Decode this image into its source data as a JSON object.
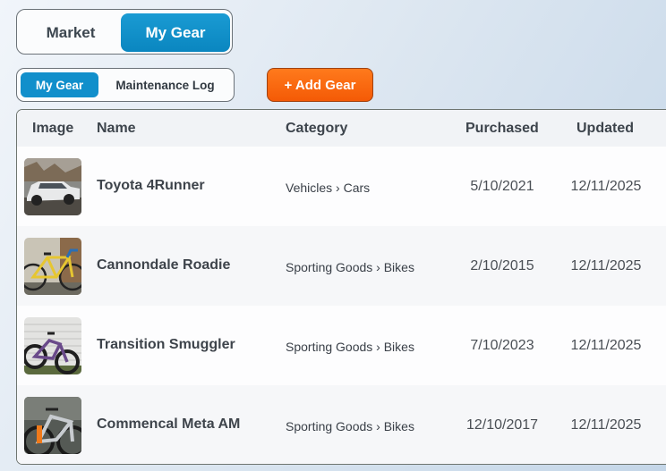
{
  "top_tabs": {
    "market": "Market",
    "my_gear": "My Gear"
  },
  "sub_tabs": {
    "my_gear": "My Gear",
    "maintenance_log": "Maintenance Log"
  },
  "add_gear_label": "+ Add Gear",
  "table": {
    "headers": {
      "image": "Image",
      "name": "Name",
      "category": "Category",
      "purchased": "Purchased",
      "updated": "Updated"
    },
    "rows": [
      {
        "name": "Toyota 4Runner",
        "category": "Vehicles › Cars",
        "purchased": "5/10/2021",
        "updated": "12/11/2025",
        "thumb": "suv"
      },
      {
        "name": "Cannondale Roadie",
        "category": "Sporting Goods › Bikes",
        "purchased": "2/10/2015",
        "updated": "12/11/2025",
        "thumb": "road-bike"
      },
      {
        "name": "Transition Smuggler",
        "category": "Sporting Goods › Bikes",
        "purchased": "7/10/2023",
        "updated": "12/11/2025",
        "thumb": "mtb-purple"
      },
      {
        "name": "Commencal Meta AM",
        "category": "Sporting Goods › Bikes",
        "purchased": "12/10/2017",
        "updated": "12/11/2025",
        "thumb": "mtb-silver"
      }
    ]
  },
  "colors": {
    "primary_blue": "#118fcb",
    "accent_orange": "#f45a06"
  }
}
